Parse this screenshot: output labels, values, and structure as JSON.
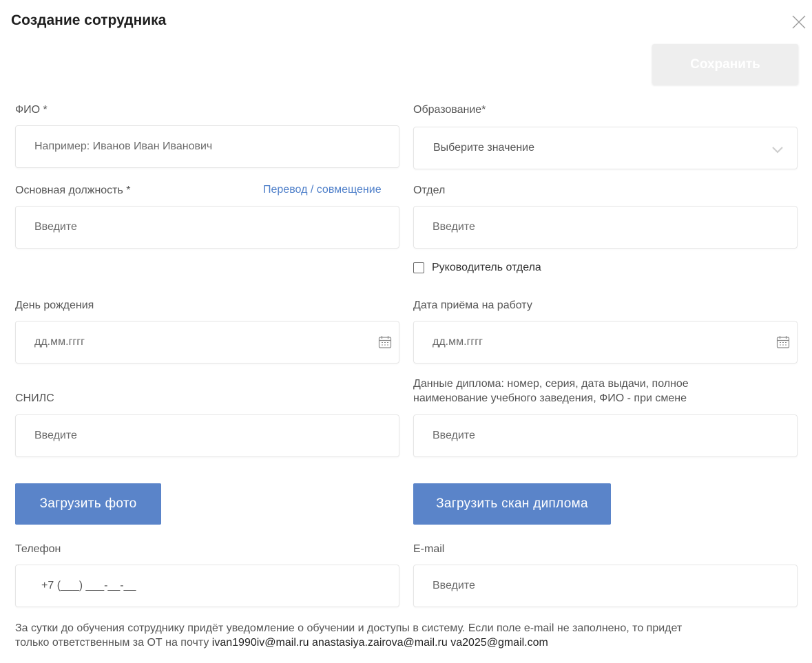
{
  "dialog": {
    "title": "Создание сотрудника",
    "save_label": "Сохранить"
  },
  "form": {
    "fio": {
      "label": "ФИО *",
      "placeholder": "Например: Иванов Иван Иванович"
    },
    "education": {
      "label": "Образование*",
      "selected": "Выберите значение"
    },
    "position": {
      "label": "Основная должность *",
      "link": "Перевод / совмещение",
      "placeholder": "Введите"
    },
    "department": {
      "label": "Отдел",
      "placeholder": "Введите"
    },
    "head_checkbox": {
      "label": "Руководитель отдела",
      "checked": false
    },
    "birthday": {
      "label": "День рождения",
      "placeholder": "дд.мм.гггг"
    },
    "hire_date": {
      "label": "Дата приёма на работу",
      "placeholder": "дд.мм.гггг"
    },
    "snils": {
      "label": "СНИЛС",
      "placeholder": "Введите"
    },
    "diploma": {
      "label_line1": "Данные диплома: номер, серия, дата выдачи, полное",
      "label_line2": "наименование учебного заведения, ФИО - при смене",
      "placeholder": "Введите"
    },
    "upload_photo": "Загрузить фото",
    "upload_diploma": "Загрузить скан диплома",
    "phone": {
      "label": "Телефон",
      "mask": "+7 (___) ___-__-__"
    },
    "email": {
      "label": "E-mail",
      "placeholder": "Введите"
    }
  },
  "note": {
    "line1": "За сутки до обучения сотруднику придёт уведомление о обучении и доступы в систему. Если поле e-mail не заполнено, то придет",
    "line2_prefix": "только ответственным за ОТ на почту ",
    "emails": "ivan1990iv@mail.ru anastasiya.zairova@mail.ru va2025@gmail.com"
  },
  "colors": {
    "accent": "#5a84c9",
    "link": "#4e7fc9",
    "save_disabled": "#eeeeee"
  },
  "icons": {
    "close": "close-icon",
    "select": "chevron-down-icon",
    "date": "calendar-icon"
  }
}
